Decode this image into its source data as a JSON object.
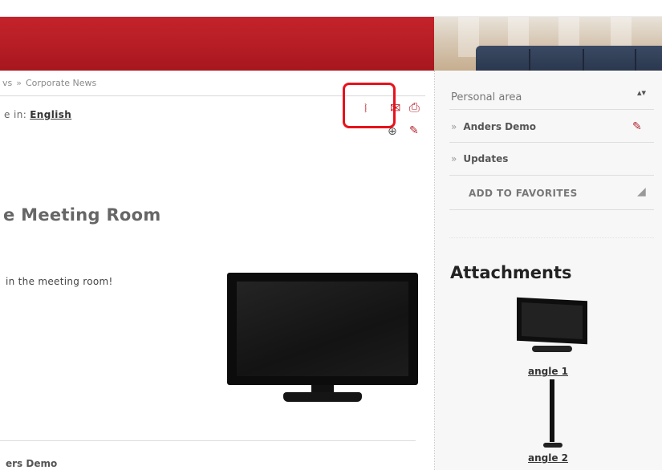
{
  "breadcrumb": {
    "parent": "vs",
    "separator": "»",
    "current": "Corporate News"
  },
  "language": {
    "label": "e in:",
    "value": "English"
  },
  "toolbar": {
    "icons": [
      "rss-icon",
      "email-icon",
      "print-icon",
      "download-icon",
      "edit-icon"
    ],
    "glyphs": {
      "rss": "⧘",
      "email": "✉",
      "print": "⎙",
      "download": "⊕",
      "edit": "✎"
    },
    "highlight_color": "#e8121c"
  },
  "article": {
    "title": "e Meeting Room",
    "body": "in the meeting room!",
    "author": "ers Demo"
  },
  "sidebar": {
    "personal_area": "Personal area",
    "updown_glyph": "▴▾",
    "user": "Anders Demo",
    "updates": "Updates",
    "add_to_favorites": "ADD TO FAVORITES",
    "raquo": "»"
  },
  "attachments": {
    "title": "Attachments",
    "items": [
      {
        "label": "angle 1"
      },
      {
        "label": "angle 2"
      }
    ]
  },
  "colors": {
    "brand_red": "#b61d25",
    "accent": "#b5222a"
  }
}
